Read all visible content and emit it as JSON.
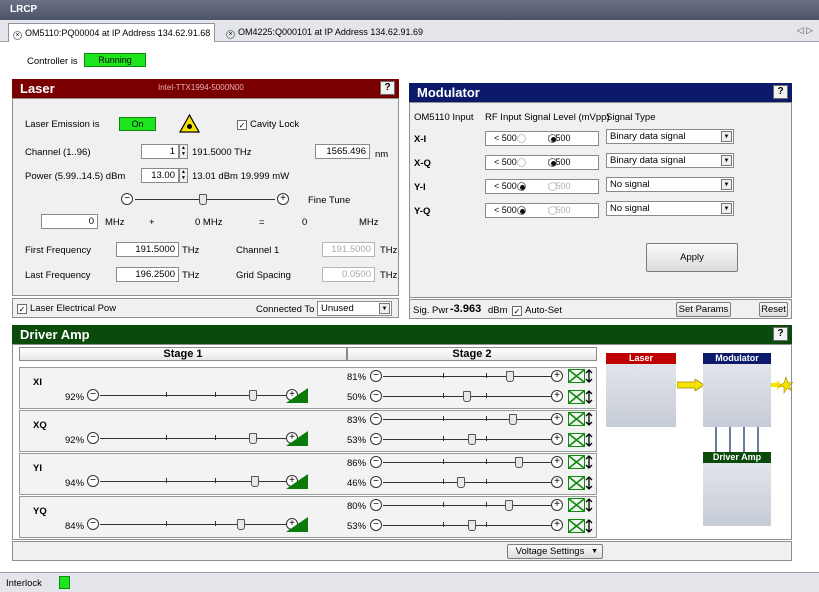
{
  "window": {
    "title": "LRCP"
  },
  "tabs": [
    {
      "label": "OM5110:PQ00004   at IP Address 134.62.91.68"
    },
    {
      "label": "OM4225:Q000101   at IP Address 134.62.91.69"
    }
  ],
  "tab_nav": "◁ ▷",
  "controller": {
    "label": "Controller is",
    "status": "Running"
  },
  "laser": {
    "title": "Laser",
    "model": "Intel-TTX1994-5000N00",
    "emission_label": "Laser Emission is",
    "emission_state": "On",
    "cavity_lock_label": "Cavity Lock",
    "cavity_lock_checked": true,
    "channel_label": "Channel (1..96)",
    "channel_value": "1",
    "channel_freq": "191.5000 THz",
    "wavelength_value": "1565.496",
    "wavelength_unit": "nm",
    "power_label": "Power (5.99..14.5) dBm",
    "power_value": "13.00",
    "power_readout": "13.01 dBm  19.999 mW",
    "fine_tune_label": "Fine Tune",
    "fine_tune_value": "0",
    "mhz": "MHz",
    "plus": "+",
    "offset": "0  MHz",
    "equals": "=",
    "result": "0",
    "mhz2": "MHz",
    "first_freq_label": "First Frequency",
    "first_freq_value": "191.5000",
    "thz": "THz",
    "last_freq_label": "Last Frequency",
    "last_freq_value": "196.2500",
    "channel1_label": "Channel 1",
    "channel1_value": "191.5000",
    "grid_label": "Grid Spacing",
    "grid_value": "0.0500",
    "elec_power_label": "Laser Electrical Pow",
    "elec_power_checked": true,
    "connected_label": "Connected To",
    "connected_value": "Unused"
  },
  "modulator": {
    "title": "Modulator",
    "col_input": "OM5110 Input",
    "col_rf": "RF Input Signal Level (mVpp)",
    "col_signal": "Signal Type",
    "lt": "< 500",
    "ge": "≥ 500",
    "rows": [
      {
        "name": "X-I",
        "selected": "ge",
        "signal": "Binary data signal"
      },
      {
        "name": "X-Q",
        "selected": "ge",
        "signal": "Binary data signal"
      },
      {
        "name": "Y-I",
        "selected": "lt",
        "signal": "No signal"
      },
      {
        "name": "Y-Q",
        "selected": "lt",
        "signal": "No signal"
      }
    ],
    "apply": "Apply",
    "sig_pwr_label": "Sig. Pwr",
    "sig_pwr_value": "-3.963",
    "sig_pwr_unit": "dBm",
    "auto_set_label": "Auto-Set",
    "auto_set_checked": true,
    "set_params": "Set Params",
    "reset": "Reset"
  },
  "driver_amp": {
    "title": "Driver Amp",
    "stage1": "Stage 1",
    "stage2": "Stage 2",
    "rows": [
      {
        "name": "XI",
        "s1": "92%",
        "s1_level": 0.85,
        "s2a": "81%",
        "s2a_level": 0.78,
        "s2b": "50%",
        "s2b_level": 0.5
      },
      {
        "name": "XQ",
        "s1": "92%",
        "s1_level": 0.85,
        "s2a": "83%",
        "s2a_level": 0.8,
        "s2b": "53%",
        "s2b_level": 0.53
      },
      {
        "name": "YI",
        "s1": "94%",
        "s1_level": 0.86,
        "s2a": "86%",
        "s2a_level": 0.84,
        "s2b": "46%",
        "s2b_level": 0.46
      },
      {
        "name": "YQ",
        "s1": "84%",
        "s1_level": 0.78,
        "s2a": "80%",
        "s2a_level": 0.77,
        "s2b": "53%",
        "s2b_level": 0.53
      }
    ],
    "diagram": {
      "laser": "Laser",
      "modulator": "Modulator",
      "driver_amp": "Driver Amp"
    },
    "voltage_settings": "Voltage Settings"
  },
  "status": {
    "interlock": "Interlock"
  },
  "colors": {
    "laser_head": "#7a0000",
    "modulator_head": "#0c1a6b",
    "driver_head": "#0a4a0a",
    "led_green": "#1ee51e"
  }
}
